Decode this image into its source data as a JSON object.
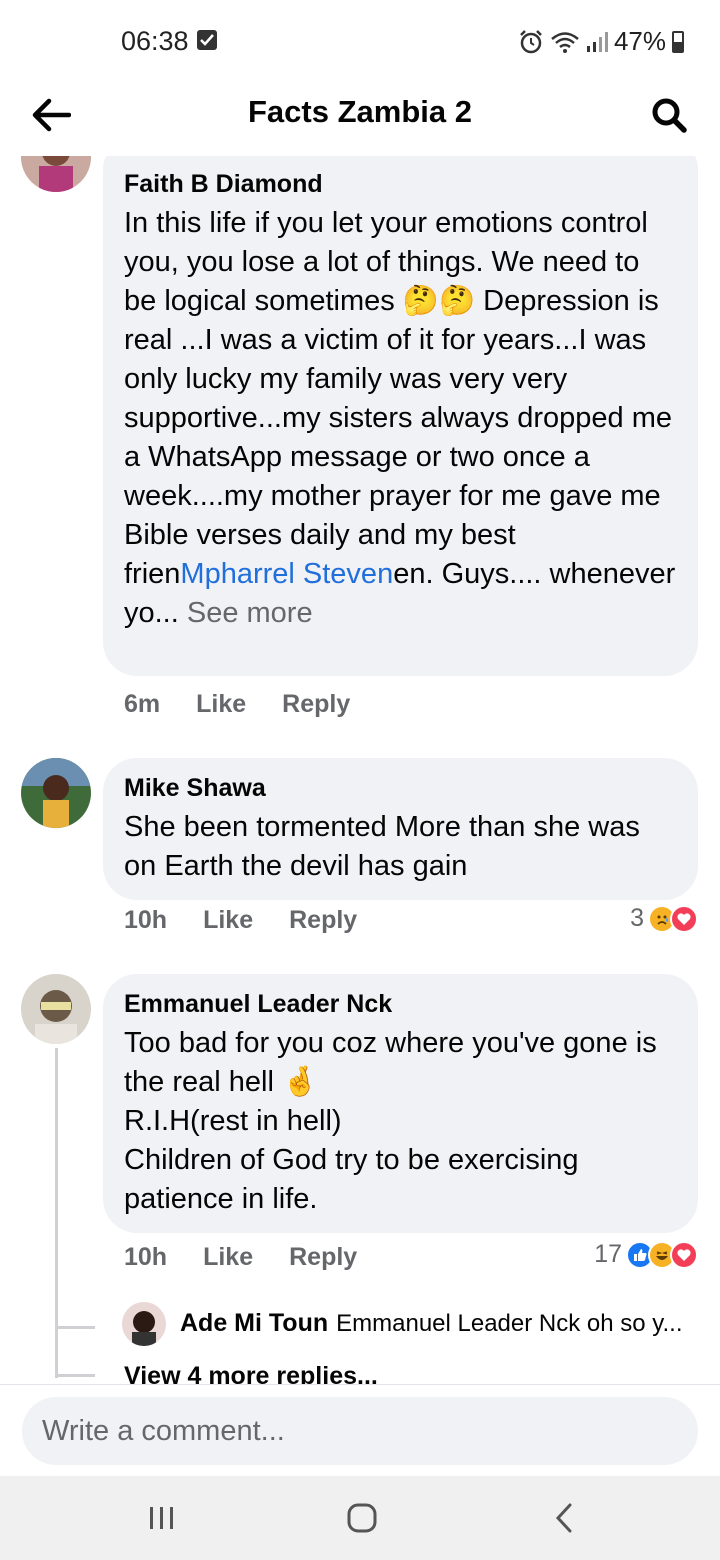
{
  "status_bar": {
    "time": "06:38",
    "battery": "47%"
  },
  "header": {
    "title": "Facts Zambia 2"
  },
  "comments": [
    {
      "author": "Faith B Diamond",
      "text_1": "In this life if you let your emotions control you, you lose a lot of things. We need to be logical sometimes ",
      "emoji_1": "🤔🤔",
      "text_2": " Depression is real ...I was a victim of it for years...I was only lucky my family was very very supportive...my sisters always dropped me a WhatsApp message or two once a week....my mother prayer for me gave me Bible verses daily and my best frien",
      "mention": "Mpharrel Steven",
      "text_3": "en. Guys.... whenever yo... ",
      "see_more": "See more",
      "time": "6m",
      "like": "Like",
      "reply": "Reply"
    },
    {
      "author": "Mike Shawa",
      "text": "She been tormented  More than she was on Earth the devil has gain",
      "time": "10h",
      "like": "Like",
      "reply": "Reply",
      "reaction_count": "3"
    },
    {
      "author": "Emmanuel Leader Nck",
      "line_1": "Too bad for you coz where you've gone is the real hell ",
      "emoji": "🤞",
      "line_2": "R.I.H(rest in hell)",
      "line_3": "Children of God try to be exercising patience in life.",
      "time": "10h",
      "like": "Like",
      "reply": "Reply",
      "reaction_count": "17",
      "reply_preview": {
        "author": "Ade Mi Toun",
        "text": "Emmanuel Leader Nck oh so y..."
      },
      "view_more": "View 4 more replies..."
    }
  ],
  "composer": {
    "placeholder": "Write a comment..."
  },
  "colors": {
    "link": "#216fdb",
    "bubble": "#f0f2f5",
    "muted": "#65676b",
    "like_blue": "#1877f2",
    "love_red": "#f33e58",
    "reaction_yellow": "#f7b125"
  }
}
